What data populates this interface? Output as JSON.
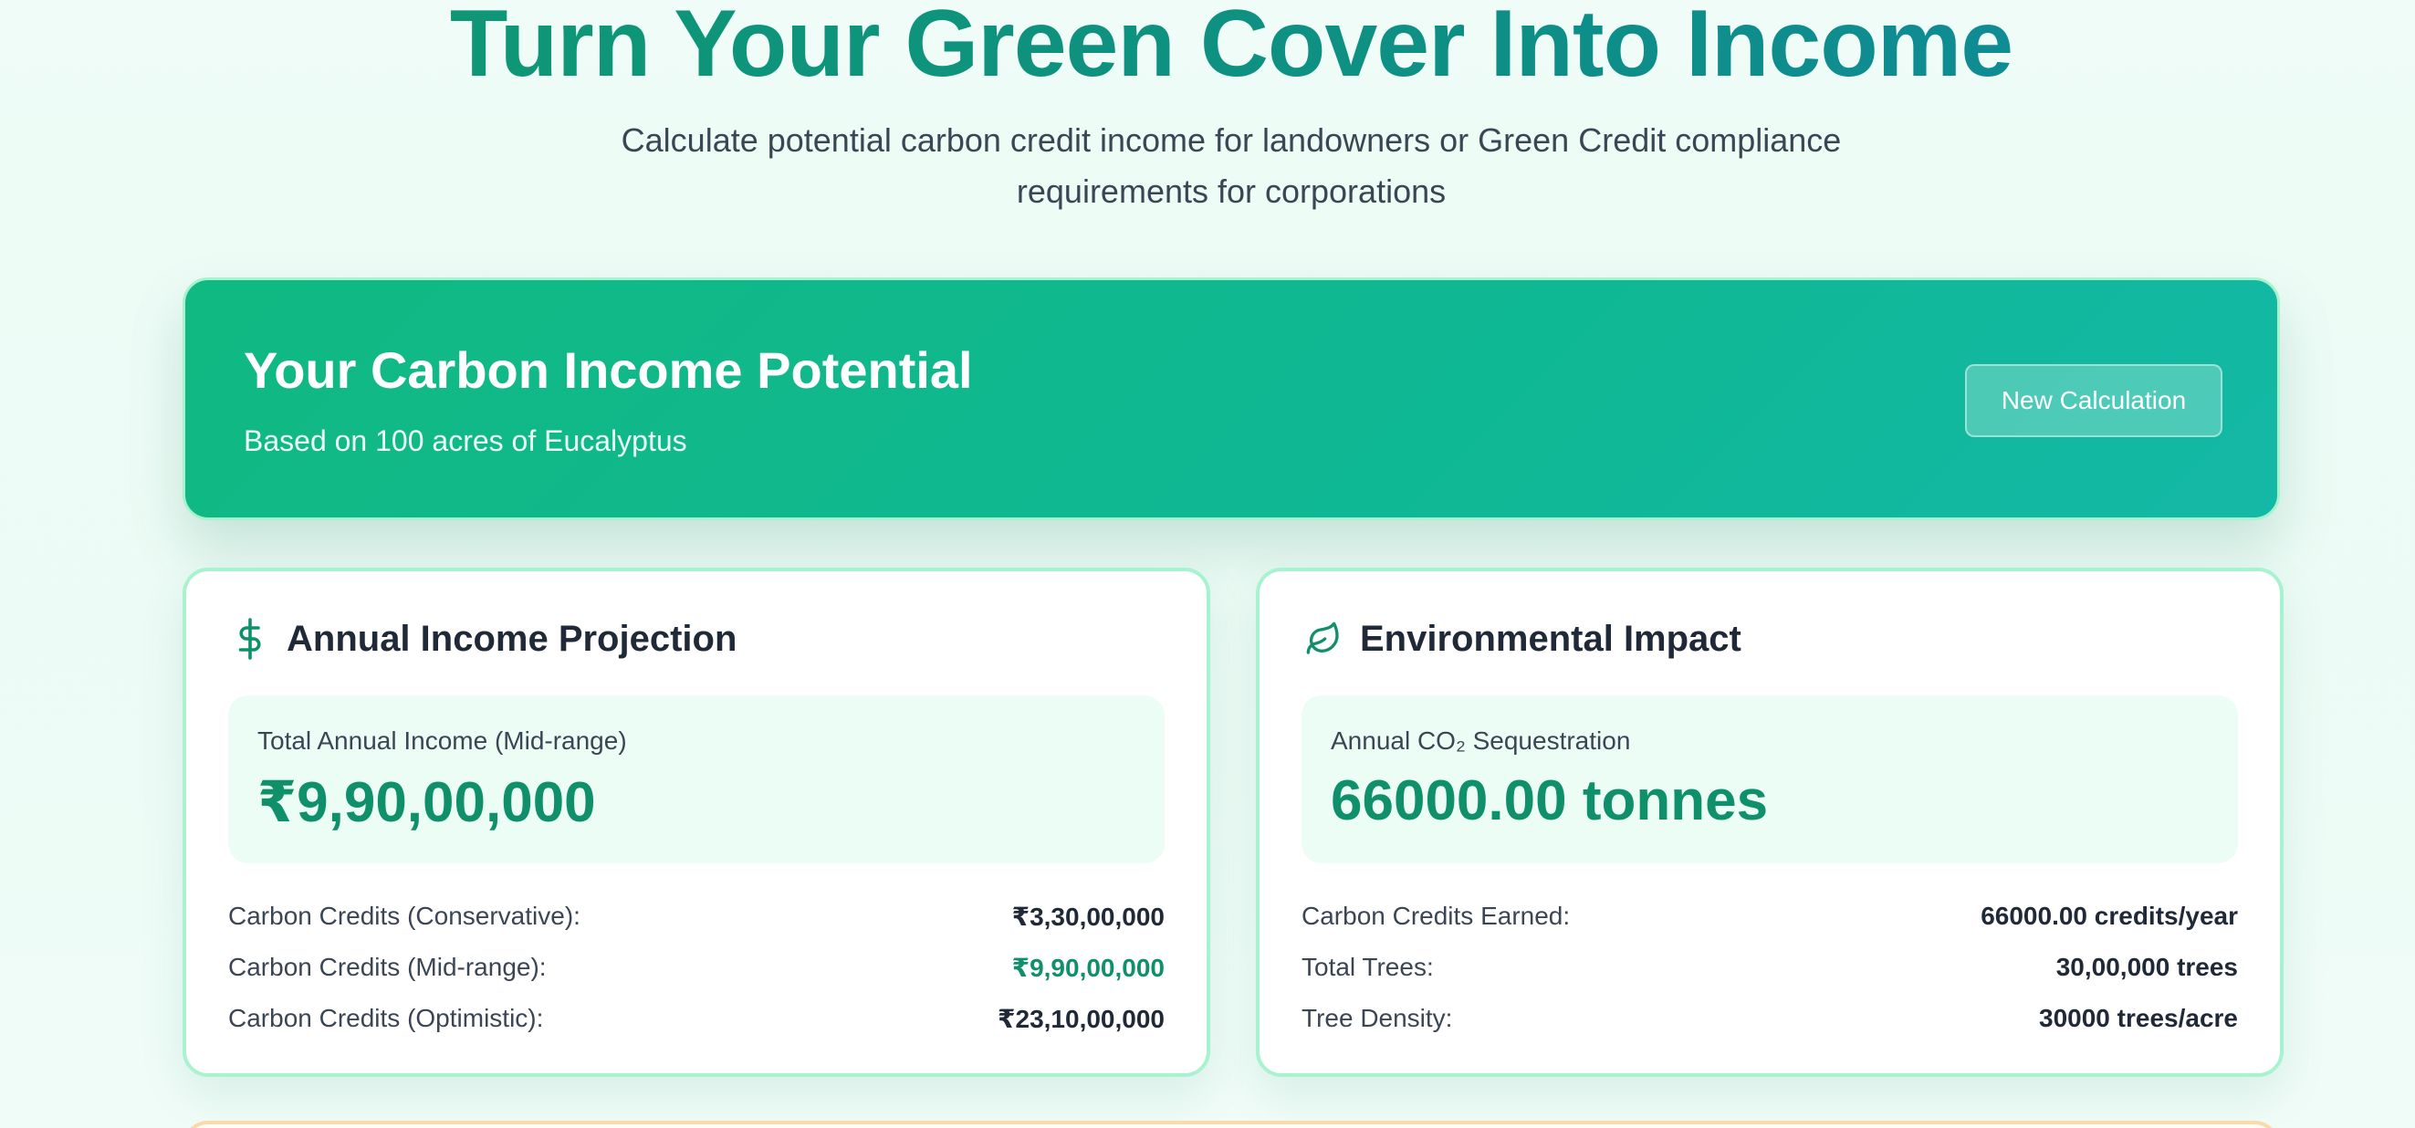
{
  "hero": {
    "title": "Turn Your Green Cover Into Income",
    "subtitle_line1": "Calculate potential carbon credit income for landowners or Green Credit compliance",
    "subtitle_line2": "requirements for corporations"
  },
  "banner": {
    "title": "Your Carbon Income Potential",
    "subtitle": "Based on 100 acres of Eucalyptus",
    "new_calc_label": "New Calculation"
  },
  "income_card": {
    "icon": "dollar-icon",
    "title": "Annual Income Projection",
    "highlight_label": "Total Annual Income (Mid-range)",
    "highlight_value": "₹9,90,00,000",
    "rows": [
      {
        "label": "Carbon Credits (Conservative):",
        "value": "₹3,30,00,000"
      },
      {
        "label": "Carbon Credits (Mid-range):",
        "value": "₹9,90,00,000"
      },
      {
        "label": "Carbon Credits (Optimistic):",
        "value": "₹23,10,00,000"
      }
    ]
  },
  "impact_card": {
    "icon": "leaf-icon",
    "title": "Environmental Impact",
    "highlight_label": "Annual CO₂ Sequestration",
    "highlight_value": "66000.00 tonnes",
    "rows": [
      {
        "label": "Carbon Credits Earned:",
        "value": "66000.00 credits/year"
      },
      {
        "label": "Total Trees:",
        "value": "30,00,000 trees"
      },
      {
        "label": "Tree Density:",
        "value": "30000 trees/acre"
      }
    ]
  },
  "colors": {
    "accent_green": "#10906a",
    "banner_start": "#10b981",
    "banner_end": "#14b8a6",
    "card_border": "#a7f3d0",
    "highlight_bg": "#ecfdf5"
  }
}
